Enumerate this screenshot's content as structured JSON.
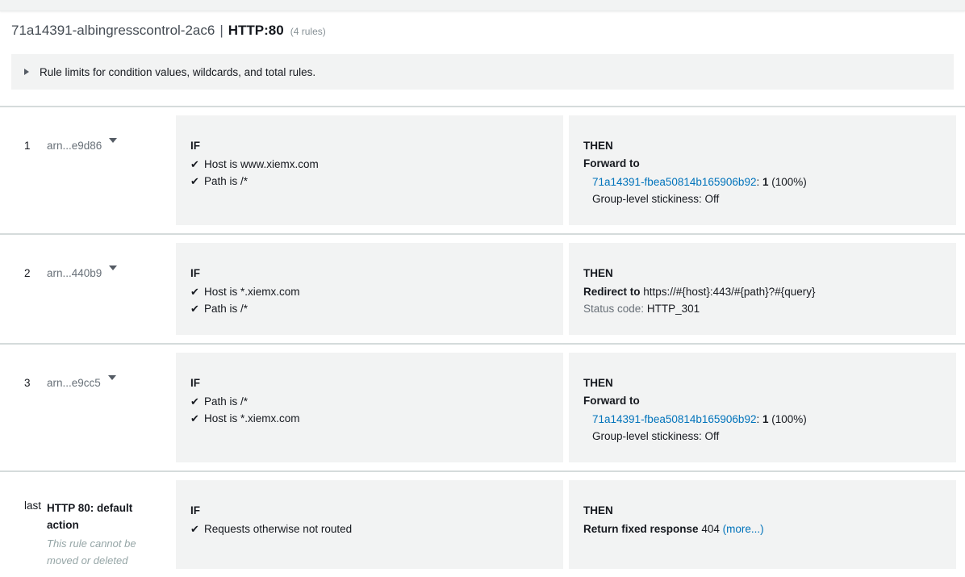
{
  "title": {
    "load_balancer": "71a14391-albingresscontrol-2ac6",
    "separator": "|",
    "protocol_port": "HTTP:80",
    "rule_count": "(4 rules)"
  },
  "limits": {
    "text": "Rule limits for condition values, wildcards, and total rules.",
    "disclosure_icon": "triangle-right-icon"
  },
  "labels": {
    "if": "IF",
    "then": "THEN",
    "check_icon": "✔",
    "caret_icon": "▼"
  },
  "rules": [
    {
      "number": "1",
      "arn": "arn...e9d86",
      "conditions": [
        "Host is www.xiemx.com",
        "Path is /*"
      ],
      "action_label": "Forward to",
      "target_group": "71a14391-fbea50814b165906b92",
      "target_sep": ":",
      "weight": "1",
      "weight_pct": "(100%)",
      "stickiness": "Group-level stickiness: Off"
    },
    {
      "number": "2",
      "arn": "arn...440b9",
      "conditions": [
        "Host is *.xiemx.com",
        "Path is /*"
      ],
      "action_label": "Redirect to",
      "redirect_url": "https://#{host}:443/#{path}?#{query}",
      "status_label": "Status code:",
      "status_code": "HTTP_301"
    },
    {
      "number": "3",
      "arn": "arn...e9cc5",
      "conditions": [
        "Path is /*",
        "Host is *.xiemx.com"
      ],
      "action_label": "Forward to",
      "target_group": "71a14391-fbea50814b165906b92",
      "target_sep": ":",
      "weight": "1",
      "weight_pct": "(100%)",
      "stickiness": "Group-level stickiness: Off"
    }
  ],
  "default_rule": {
    "number": "last",
    "title": "HTTP 80: default action",
    "note": "This rule cannot be moved or deleted",
    "condition": "Requests otherwise not routed",
    "action_label": "Return fixed response",
    "response_code": "404",
    "more_link": "(more...)"
  },
  "colors": {
    "link": "#0073bb",
    "panel_bg": "#f2f3f3",
    "divider": "#d5dbdb",
    "muted_text": "#687078"
  }
}
